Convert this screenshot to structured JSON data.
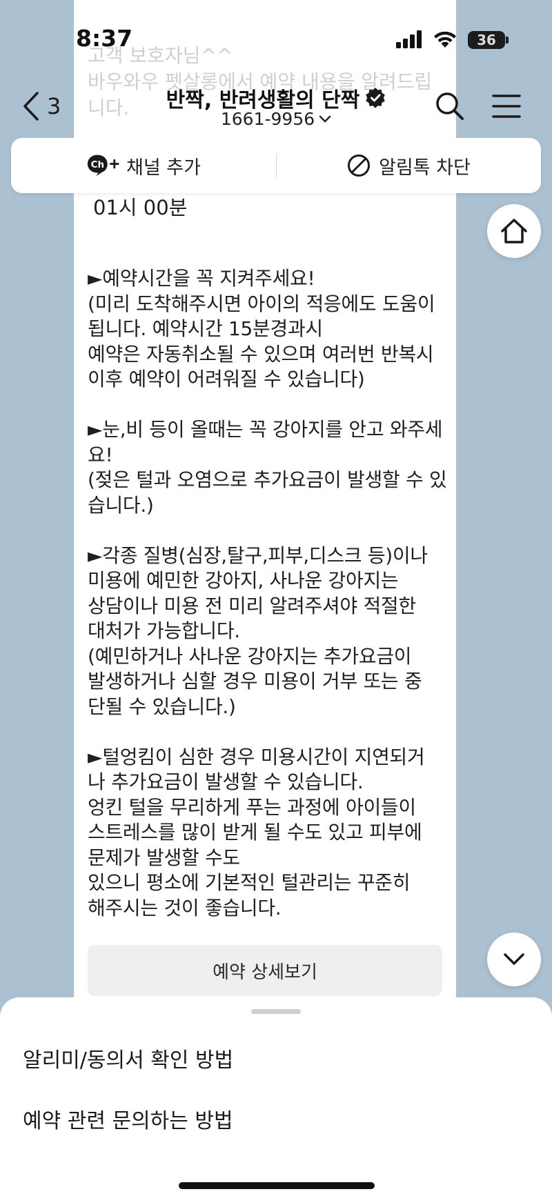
{
  "status_bar": {
    "time": "8:37",
    "battery": "36"
  },
  "header": {
    "back_count": "3",
    "channel_name": "반짝, 반려생활의 단짝",
    "phone": "1661-9956"
  },
  "actions": {
    "add_channel": "채널 추가",
    "block_alimtalk": "알림톡 차단"
  },
  "message": {
    "faded_greeting": "고객 보호자님^^\n바우와우 펫살롱에서 예약 내용을 알려드립니다.",
    "time_line": "01시 00분",
    "body": "►예약시간을 꼭 지켜주세요!\n(미리 도착해주시면 아이의 적응에도 도움이 됩니다. 예약시간 15분경과시\n예약은 자동취소될 수 있으며 여러번 반복시 이후 예약이 어려워질 수 있습니다)\n\n►눈,비 등이 올때는 꼭 강아지를 안고 와주세요!\n(젖은 털과 오염으로 추가요금이 발생할 수 있습니다.)\n\n►각종 질병(심장,탈구,피부,디스크 등)이나\n 미용에 예민한 강아지, 사나운 강아지는\n상담이나 미용 전 미리 알려주셔야 적절한\n대처가 가능합니다.\n(예민하거나 사나운 강아지는 추가요금이\n발생하거나 심할 경우 미용이 거부 또는 중\n단될 수 있습니다.)\n\n►털엉킴이 심한 경우 미용시간이 지연되거\n나 추가요금이 발생할 수 있습니다.\n엉킨 털을 무리하게 푸는 과정에 아이들이\n스트레스를 많이 받게 될 수도 있고 피부에\n문제가 발생할 수도\n있으니 평소에 기본적인 털관리는 꾸준히\n해주시는 것이 좋습니다.",
    "detail_button": "예약 상세보기"
  },
  "bottom_sheet": {
    "items": [
      {
        "label": "알리미/동의서 확인 방법"
      },
      {
        "label": "예약 관련 문의하는 방법"
      }
    ]
  },
  "colors": {
    "background": "#abc1d1",
    "bubble": "#ffffff",
    "verified_badge": "#1a1a1a"
  }
}
